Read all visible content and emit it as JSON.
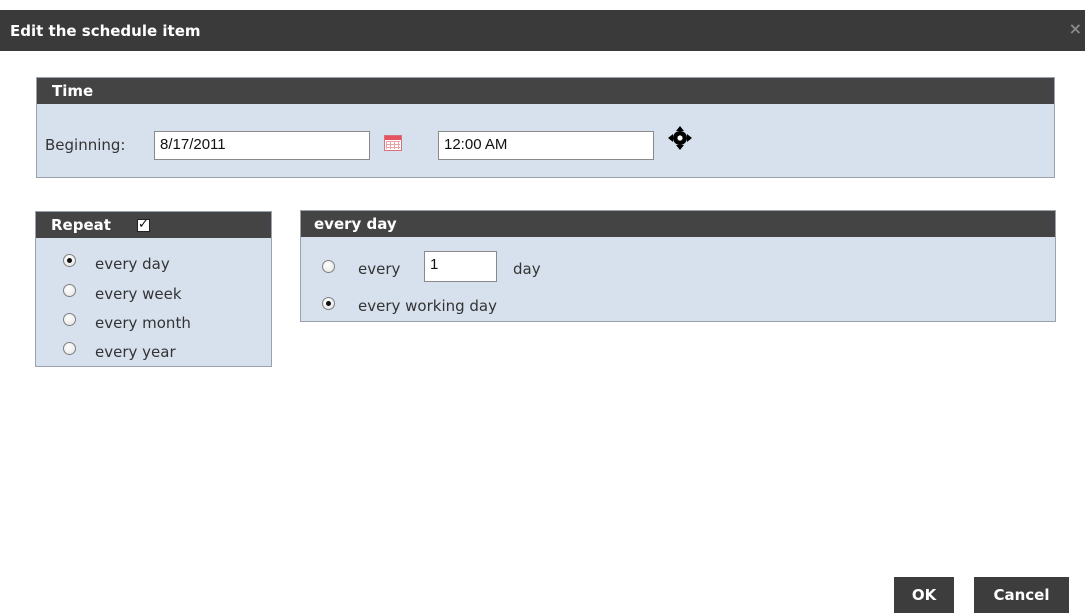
{
  "dialog": {
    "title": "Edit the schedule item",
    "close_glyph": "×"
  },
  "time_section": {
    "header": "Time",
    "beginning_label": "Beginning:",
    "date_value": "8/17/2011",
    "calendar_icon": "calendar-icon",
    "time_value": "12:00 AM",
    "move_icon": "move-arrows-icon"
  },
  "repeat_section": {
    "header": "Repeat",
    "checked": true,
    "options": [
      {
        "label": "every day",
        "selected": true
      },
      {
        "label": "every week",
        "selected": false
      },
      {
        "label": "every month",
        "selected": false
      },
      {
        "label": "every year",
        "selected": false
      }
    ]
  },
  "every_day_section": {
    "header": "every day",
    "option_every_prefix": "every",
    "interval_value": "1",
    "option_every_suffix": "day",
    "option_every_selected": false,
    "option_working_day": "every working day",
    "option_working_day_selected": true
  },
  "buttons": {
    "ok": "OK",
    "cancel": "Cancel"
  },
  "colors": {
    "header_bg": "#444444",
    "panel_bg": "#d7e1ee",
    "titlebar_bg": "#3a3a3a"
  }
}
